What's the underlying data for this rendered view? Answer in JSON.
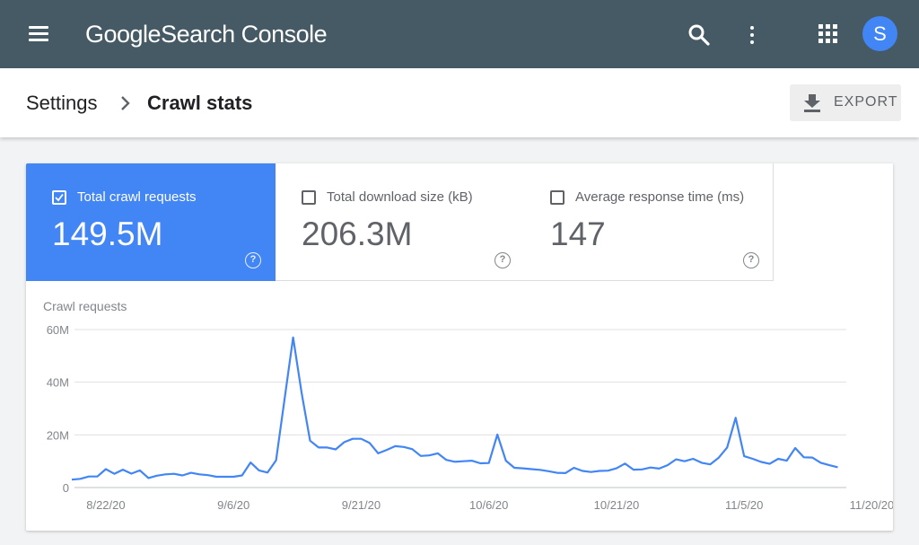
{
  "app": {
    "brand_google": "Google",
    "brand_product": "Search Console",
    "avatar_letter": "S"
  },
  "icons": {
    "menu": "menu-icon",
    "search": "search-icon",
    "more": "more-vert-icon",
    "apps": "apps-grid-icon",
    "chevron": "chevron-right-icon",
    "download": "download-icon",
    "help": "help-circle-icon",
    "checkbox_checked": "checkbox-checked-icon",
    "checkbox_empty": "checkbox-empty-icon"
  },
  "breadcrumb": {
    "root": "Settings",
    "current": "Crawl stats"
  },
  "toolbar": {
    "export_label": "EXPORT"
  },
  "metrics": [
    {
      "label": "Total crawl requests",
      "value": "149.5M",
      "selected": true
    },
    {
      "label": "Total download size (kB)",
      "value": "206.3M",
      "selected": false
    },
    {
      "label": "Average response time (ms)",
      "value": "147",
      "selected": false
    }
  ],
  "colors": {
    "appbar": "#455a64",
    "accent": "#4285f4",
    "line": "#4285f4"
  },
  "chart_data": {
    "type": "line",
    "title": "Crawl requests",
    "xlabel": "",
    "ylabel": "",
    "ylim": [
      0,
      60
    ],
    "y_ticks": [
      {
        "value": 0,
        "label": "0"
      },
      {
        "value": 20,
        "label": "20M"
      },
      {
        "value": 40,
        "label": "40M"
      },
      {
        "value": 60,
        "label": "60M"
      }
    ],
    "x_range": [
      0,
      91
    ],
    "x_ticks": [
      {
        "x": 4,
        "label": "8/22/20"
      },
      {
        "x": 19,
        "label": "9/6/20"
      },
      {
        "x": 34,
        "label": "9/21/20"
      },
      {
        "x": 49,
        "label": "10/6/20"
      },
      {
        "x": 64,
        "label": "10/21/20"
      },
      {
        "x": 79,
        "label": "11/5/20"
      },
      {
        "x": 94,
        "label": "11/20/20"
      }
    ],
    "grid": true,
    "series": [
      {
        "values": [
          3,
          3.3,
          4.2,
          4.2,
          7,
          5.2,
          6.8,
          5.3,
          6.5,
          3.6,
          4.5,
          5,
          5.2,
          4.6,
          5.6,
          5,
          4.7,
          4.1,
          4.1,
          4.1,
          4.6,
          9.5,
          6.5,
          5.7,
          10.3,
          33.6,
          57,
          35.9,
          17.8,
          15.2,
          15.2,
          14.5,
          17.2,
          18.5,
          18.5,
          16.9,
          13,
          14.3,
          15.7,
          15.4,
          14.6,
          12,
          12.2,
          13,
          10.5,
          9.8,
          10,
          10.2,
          9.2,
          9.3,
          20.1,
          10.2,
          7.5,
          7.3,
          7,
          6.7,
          6.2,
          5.6,
          5.5,
          7.5,
          6.3,
          5.9,
          6.3,
          6.4,
          7.3,
          9.1,
          6.8,
          6.9,
          7.6,
          7.2,
          8.5,
          10.7,
          10,
          10.9,
          9.4,
          8.8,
          11.3,
          15.2,
          26.5,
          11.9,
          10.9,
          9.7,
          9,
          10.9,
          10.2,
          15,
          11.5,
          11.4,
          9.4,
          8.5,
          7.7
        ]
      }
    ]
  }
}
